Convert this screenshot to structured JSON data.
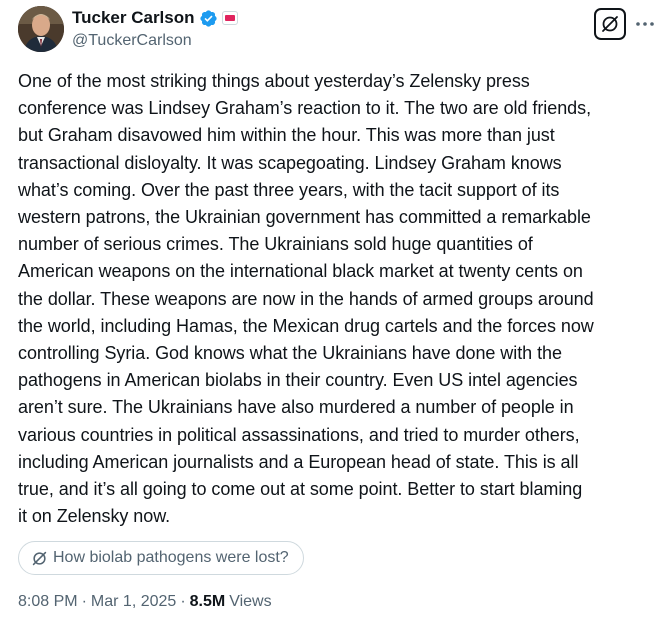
{
  "author": {
    "display_name": "Tucker Carlson",
    "handle": "@TuckerCarlson",
    "verified": true,
    "avatar_icon": "profile-photo",
    "badge_icon": "affiliate-badge"
  },
  "actions": {
    "grok_icon": "grok-icon",
    "more_icon": "more-horizontal-icon"
  },
  "tweet": {
    "lines": [
      "One of the most striking things about yesterday’s Zelensky press",
      "conference was Lindsey Graham’s reaction to it. The two are old friends,",
      "but Graham disavowed him within the hour. This was more than just",
      "transactional disloyalty. It was scapegoating. Lindsey Graham knows",
      "what’s coming. Over the past three years, with the tacit support of its",
      "western patrons, the Ukrainian government has committed a remarkable",
      "number of serious crimes. The Ukrainians sold huge quantities of",
      "American weapons on the international black market at twenty cents on",
      "the dollar. These weapons are now in the hands of armed groups around",
      "the world, including Hamas, the Mexican drug cartels and the forces now",
      "controlling Syria. God knows what the Ukrainians have done with the",
      "pathogens in American biolabs in their country. Even US intel agencies",
      "aren’t sure. The Ukrainians have also murdered a number of people in",
      "various countries in political assassinations, and tried to murder others,",
      "including American journalists and a European head of state. This is all",
      "true, and it’s all going to come out at some point. Better to start blaming",
      "it on Zelensky now."
    ]
  },
  "related": {
    "label": "How biolab pathogens were lost?",
    "icon": "grok-icon"
  },
  "meta": {
    "time": "8:08 PM",
    "separator": "·",
    "date": "Mar 1, 2025",
    "views_count": "8.5M",
    "views_label": "Views"
  },
  "colors": {
    "text": "#0f1419",
    "secondary": "#536471",
    "verified": "#1d9bf0",
    "border": "#cfd9de"
  }
}
